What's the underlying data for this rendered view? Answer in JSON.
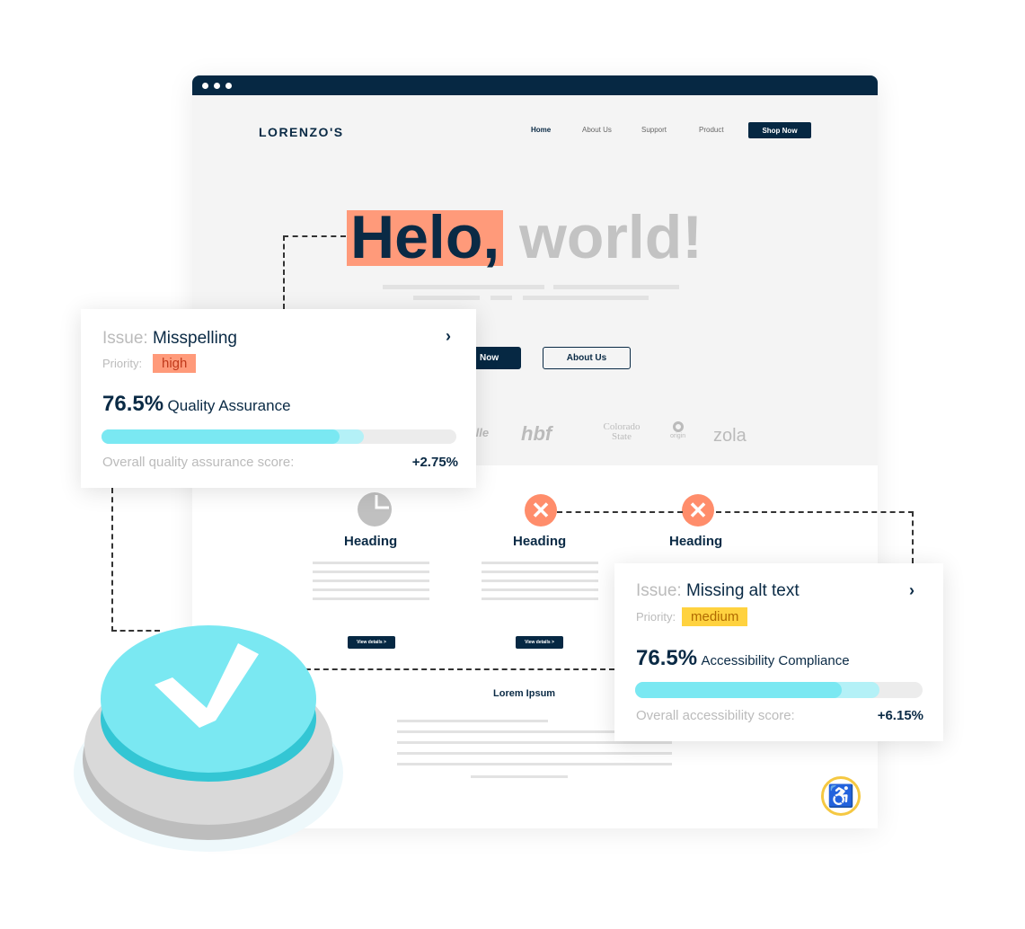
{
  "site": {
    "logo": "LORENZO'S",
    "nav": [
      "Home",
      "About Us",
      "Support",
      "Product"
    ],
    "shop_now": "Shop Now",
    "hero_misspelled": "Helo,",
    "hero_rest": "world!",
    "cta_primary": "Now",
    "cta_secondary": "About Us",
    "brands": [
      "ille",
      "hbf",
      "Colorado State",
      "origin",
      "zola"
    ],
    "features": [
      {
        "heading": "Heading",
        "button": "View details >",
        "icon": "pie-chart-icon"
      },
      {
        "heading": "Heading",
        "button": "View details >",
        "icon": "error-x-icon"
      },
      {
        "heading": "Heading",
        "icon": "error-x-icon"
      }
    ],
    "section_title": "Lorem Ipsum"
  },
  "issue_cards": [
    {
      "issue_label": "Issue:",
      "issue": "Misspelling",
      "priority_label": "Priority:",
      "priority": "high",
      "priority_color": "#ff9a7a",
      "score": "76.5%",
      "score_label": "Quality Assurance",
      "progress": 76.5,
      "footer": "Overall quality assurance score:",
      "delta": "+2.75%"
    },
    {
      "issue_label": "Issue:",
      "issue": "Missing alt text",
      "priority_label": "Priority:",
      "priority": "medium",
      "priority_color": "#ffd23f",
      "score": "76.5%",
      "score_label": "Accessibility Compliance",
      "progress": 76.5,
      "footer": "Overall accessibility score:",
      "delta": "+6.15%"
    }
  ],
  "colors": {
    "navy": "#062843",
    "cyan": "#7ae8f2",
    "error": "#ff8d6b",
    "accessibility": "#f5c842"
  }
}
